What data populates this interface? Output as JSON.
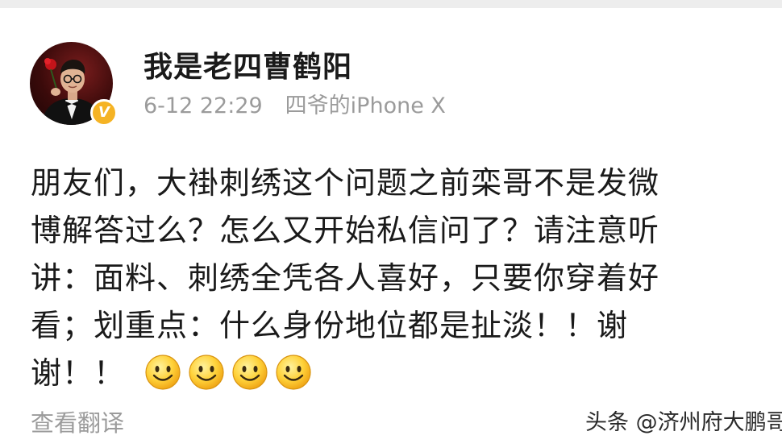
{
  "post": {
    "username": "我是老四曹鹤阳",
    "timestamp": "6-12 22:29",
    "device": "四爷的iPhone X",
    "verified_badge": "V",
    "content_lines": [
      "朋友们，大褂刺绣这个问题之前栾哥不是发微",
      "博解答过么？怎么又开始私信问了？请注意听",
      "讲：面料、刺绣全凭各人喜好，只要你穿着好",
      "看；划重点：什么身份地位都是扯淡！！谢",
      "谢！！"
    ],
    "emojis": [
      "smiley-icon",
      "smiley-icon",
      "smiley-icon",
      "smiley-icon"
    ],
    "translate_label": "查看翻译"
  },
  "watermark": "头条 @济州府大鹏哥",
  "colors": {
    "badge": "#f5b324",
    "meta_text": "#9b9b9b",
    "body_text": "#1a1a1a",
    "top_strip": "#ededed"
  }
}
